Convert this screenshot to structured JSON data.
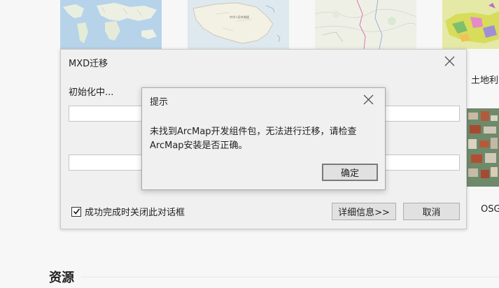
{
  "gallery": {
    "items": [
      {
        "name": "world-map",
        "label": ""
      },
      {
        "name": "china-map",
        "label": "",
        "map_text": "中华人民共和国"
      },
      {
        "name": "terrain-map",
        "label": ""
      },
      {
        "name": "landuse-map",
        "label": "土地利"
      },
      {
        "name": "osgb-model",
        "label": "OSG"
      }
    ],
    "section_title": "资源"
  },
  "main_dialog": {
    "title": "MXD迁移",
    "status_text": "初始化中...",
    "progress": [
      0,
      0
    ],
    "checkbox": {
      "label": "成功完成时关闭此对话框",
      "checked": true
    },
    "details_button": "详细信息>>",
    "cancel_button": "取消",
    "close_icon": "close-icon"
  },
  "message_box": {
    "title": "提示",
    "message": "未找到ArcMap开发组件包，无法进行迁移，请检查ArcMap安装是否正确。",
    "ok_button": "确定",
    "close_icon": "close-icon"
  },
  "colors": {
    "dialog_bg": "#f0f0f0",
    "button_bg": "#e1e1e1",
    "primary_border": "#7a7a7a"
  }
}
